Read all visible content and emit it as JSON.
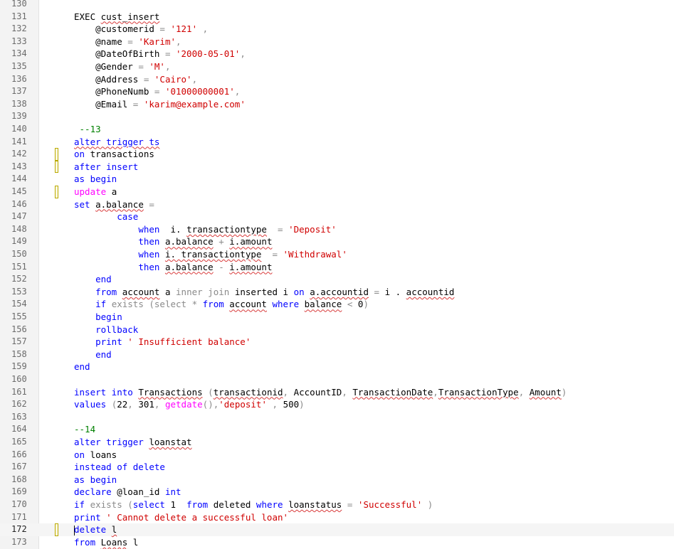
{
  "editor": {
    "current_line": 172,
    "lines": [
      {
        "n": "130",
        "m": false,
        "t": []
      },
      {
        "n": "131",
        "m": false,
        "t": [
          [
            "n",
            "EXEC "
          ],
          [
            "w",
            "cust_insert"
          ]
        ]
      },
      {
        "n": "132",
        "m": false,
        "t": [
          [
            "n",
            "    @customerid "
          ],
          [
            "g",
            "= "
          ],
          [
            "s",
            "'121'"
          ],
          [
            "g",
            " ,"
          ]
        ]
      },
      {
        "n": "133",
        "m": false,
        "t": [
          [
            "n",
            "    @name "
          ],
          [
            "g",
            "= "
          ],
          [
            "s",
            "'Karim'"
          ],
          [
            "g",
            ","
          ]
        ]
      },
      {
        "n": "134",
        "m": false,
        "t": [
          [
            "n",
            "    @DateOfBirth "
          ],
          [
            "g",
            "= "
          ],
          [
            "s",
            "'2000-05-01'"
          ],
          [
            "g",
            ","
          ]
        ]
      },
      {
        "n": "135",
        "m": false,
        "t": [
          [
            "n",
            "    @Gender "
          ],
          [
            "g",
            "= "
          ],
          [
            "s",
            "'M'"
          ],
          [
            "g",
            ","
          ]
        ]
      },
      {
        "n": "136",
        "m": false,
        "t": [
          [
            "n",
            "    @Address "
          ],
          [
            "g",
            "= "
          ],
          [
            "s",
            "'Cairo'"
          ],
          [
            "g",
            ","
          ]
        ]
      },
      {
        "n": "137",
        "m": false,
        "t": [
          [
            "n",
            "    @PhoneNumb "
          ],
          [
            "g",
            "= "
          ],
          [
            "s",
            "'01000000001'"
          ],
          [
            "g",
            ","
          ]
        ]
      },
      {
        "n": "138",
        "m": false,
        "t": [
          [
            "n",
            "    @Email "
          ],
          [
            "g",
            "= "
          ],
          [
            "s",
            "'karim@example.com'"
          ]
        ]
      },
      {
        "n": "139",
        "m": false,
        "t": []
      },
      {
        "n": "140",
        "m": false,
        "t": [
          [
            "c",
            " --13"
          ]
        ]
      },
      {
        "n": "141",
        "m": false,
        "t": [
          [
            "kw",
            "alter trigger ts"
          ]
        ]
      },
      {
        "n": "142",
        "m": true,
        "t": [
          [
            "k",
            "on "
          ],
          [
            "n",
            "transactions"
          ]
        ]
      },
      {
        "n": "143",
        "m": true,
        "t": [
          [
            "k",
            "after insert"
          ]
        ]
      },
      {
        "n": "144",
        "m": false,
        "t": [
          [
            "k",
            "as begin"
          ]
        ]
      },
      {
        "n": "145",
        "m": true,
        "t": [
          [
            "f",
            "update "
          ],
          [
            "n",
            "a"
          ]
        ]
      },
      {
        "n": "146",
        "m": false,
        "t": [
          [
            "k",
            "set "
          ],
          [
            "w",
            "a.balance"
          ],
          [
            "g",
            " ="
          ]
        ]
      },
      {
        "n": "147",
        "m": false,
        "t": [
          [
            "n",
            "        "
          ],
          [
            "k",
            "case"
          ]
        ]
      },
      {
        "n": "148",
        "m": false,
        "t": [
          [
            "n",
            "            "
          ],
          [
            "k",
            "when"
          ],
          [
            "n",
            "  i. "
          ],
          [
            "w",
            "transactiontype"
          ],
          [
            "g",
            "  = "
          ],
          [
            "s",
            "'Deposit'"
          ]
        ]
      },
      {
        "n": "149",
        "m": false,
        "t": [
          [
            "n",
            "            "
          ],
          [
            "k",
            "then "
          ],
          [
            "w",
            "a.balance"
          ],
          [
            "g",
            " + "
          ],
          [
            "w",
            "i.amount"
          ]
        ]
      },
      {
        "n": "150",
        "m": false,
        "t": [
          [
            "n",
            "            "
          ],
          [
            "k",
            "when "
          ],
          [
            "w",
            "i. transactiontype"
          ],
          [
            "g",
            "  = "
          ],
          [
            "s",
            "'Withdrawal'"
          ]
        ]
      },
      {
        "n": "151",
        "m": false,
        "t": [
          [
            "n",
            "            "
          ],
          [
            "k",
            "then "
          ],
          [
            "w",
            "a.balance"
          ],
          [
            "g",
            " - "
          ],
          [
            "w",
            "i.amount"
          ]
        ]
      },
      {
        "n": "152",
        "m": false,
        "t": [
          [
            "n",
            "    "
          ],
          [
            "k",
            "end"
          ]
        ]
      },
      {
        "n": "153",
        "m": false,
        "t": [
          [
            "n",
            "    "
          ],
          [
            "k",
            "from "
          ],
          [
            "w",
            "account"
          ],
          [
            "n",
            " a "
          ],
          [
            "g",
            "inner join "
          ],
          [
            "n",
            "inserted i "
          ],
          [
            "k",
            "on "
          ],
          [
            "w",
            "a.accountid"
          ],
          [
            "g",
            " = "
          ],
          [
            "n",
            "i . "
          ],
          [
            "w",
            "accountid"
          ]
        ]
      },
      {
        "n": "154",
        "m": false,
        "t": [
          [
            "n",
            "    "
          ],
          [
            "k",
            "if "
          ],
          [
            "g",
            "exists (select "
          ],
          [
            "g",
            "* "
          ],
          [
            "k",
            "from "
          ],
          [
            "w",
            "account"
          ],
          [
            "k",
            " where "
          ],
          [
            "w",
            "balance"
          ],
          [
            "g",
            " < "
          ],
          [
            "n",
            "0"
          ],
          [
            "g",
            ")"
          ]
        ]
      },
      {
        "n": "155",
        "m": false,
        "t": [
          [
            "n",
            "    "
          ],
          [
            "k",
            "begin"
          ]
        ]
      },
      {
        "n": "156",
        "m": false,
        "t": [
          [
            "n",
            "    "
          ],
          [
            "k",
            "rollback"
          ]
        ]
      },
      {
        "n": "157",
        "m": false,
        "t": [
          [
            "n",
            "    "
          ],
          [
            "k",
            "print "
          ],
          [
            "s",
            "' Insufficient balance'"
          ]
        ]
      },
      {
        "n": "158",
        "m": false,
        "t": [
          [
            "n",
            "    "
          ],
          [
            "k",
            "end"
          ]
        ]
      },
      {
        "n": "159",
        "m": false,
        "t": [
          [
            "k",
            "end"
          ]
        ]
      },
      {
        "n": "160",
        "m": false,
        "t": []
      },
      {
        "n": "161",
        "m": false,
        "t": [
          [
            "k",
            "insert into "
          ],
          [
            "w",
            "Transactions"
          ],
          [
            "g",
            " ("
          ],
          [
            "w",
            "transactionid"
          ],
          [
            "g",
            ", "
          ],
          [
            "n",
            "AccountID"
          ],
          [
            "g",
            ", "
          ],
          [
            "w",
            "TransactionDate"
          ],
          [
            "g",
            ","
          ],
          [
            "w",
            "TransactionType"
          ],
          [
            "g",
            ", "
          ],
          [
            "w",
            "Amount"
          ],
          [
            "g",
            ")"
          ]
        ]
      },
      {
        "n": "162",
        "m": false,
        "t": [
          [
            "k",
            "values "
          ],
          [
            "g",
            "("
          ],
          [
            "n",
            "22"
          ],
          [
            "g",
            ", "
          ],
          [
            "n",
            "301"
          ],
          [
            "g",
            ", "
          ],
          [
            "f",
            "getdate"
          ],
          [
            "g",
            "(),"
          ],
          [
            "s",
            "'deposit'"
          ],
          [
            "g",
            " , "
          ],
          [
            "n",
            "500"
          ],
          [
            "g",
            ")"
          ]
        ]
      },
      {
        "n": "163",
        "m": false,
        "t": []
      },
      {
        "n": "164",
        "m": false,
        "t": [
          [
            "c",
            "--14"
          ]
        ]
      },
      {
        "n": "165",
        "m": false,
        "t": [
          [
            "k",
            "alter trigger "
          ],
          [
            "w",
            "loanstat"
          ]
        ]
      },
      {
        "n": "166",
        "m": false,
        "t": [
          [
            "k",
            "on "
          ],
          [
            "n",
            "loans"
          ]
        ]
      },
      {
        "n": "167",
        "m": false,
        "t": [
          [
            "k",
            "instead of delete"
          ]
        ]
      },
      {
        "n": "168",
        "m": false,
        "t": [
          [
            "k",
            "as begin"
          ]
        ]
      },
      {
        "n": "169",
        "m": false,
        "t": [
          [
            "k",
            "declare "
          ],
          [
            "n",
            "@loan_id "
          ],
          [
            "k",
            "int"
          ]
        ]
      },
      {
        "n": "170",
        "m": false,
        "t": [
          [
            "k",
            "if "
          ],
          [
            "g",
            "exists ("
          ],
          [
            "k",
            "select "
          ],
          [
            "n",
            "1  "
          ],
          [
            "k",
            "from "
          ],
          [
            "n",
            "deleted "
          ],
          [
            "k",
            "where "
          ],
          [
            "w",
            "loanstatus"
          ],
          [
            "g",
            " = "
          ],
          [
            "s",
            "'Successful'"
          ],
          [
            "g",
            " )"
          ]
        ]
      },
      {
        "n": "171",
        "m": false,
        "t": [
          [
            "k",
            "print "
          ],
          [
            "s",
            "' Cannot delete a successful loan'"
          ]
        ]
      },
      {
        "n": "172",
        "m": true,
        "t": [
          [
            "caret",
            ""
          ],
          [
            "k",
            "delete "
          ],
          [
            "w",
            "l"
          ]
        ]
      },
      {
        "n": "173",
        "m": false,
        "t": [
          [
            "k",
            "from "
          ],
          [
            "w",
            "Loans"
          ],
          [
            "n",
            " l"
          ]
        ]
      }
    ]
  },
  "colors": {
    "keyword": "#0000ff",
    "string": "#d00000",
    "operator": "#8a8a8a",
    "function": "#ff00ff",
    "comment": "#008000",
    "squiggle": "#d83a3a"
  }
}
